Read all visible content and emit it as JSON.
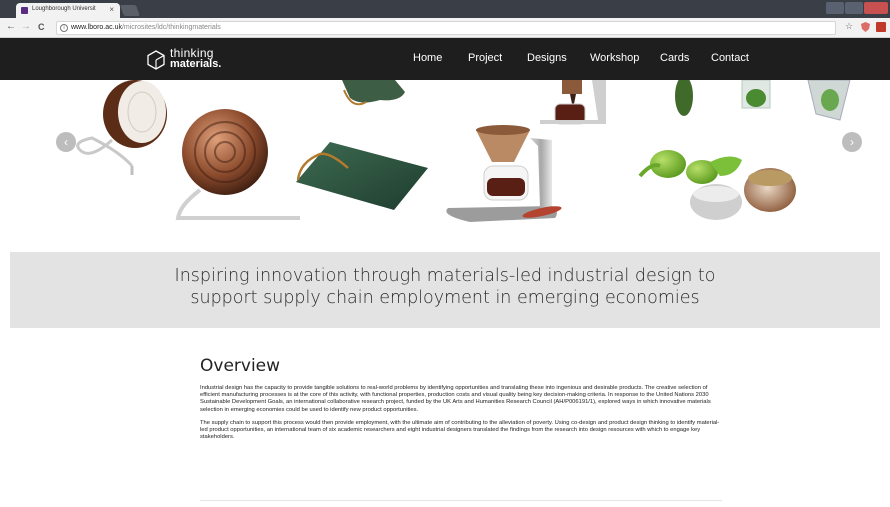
{
  "browser": {
    "tab_title": "Loughborough Universit",
    "tab_close": "×",
    "url_host": "www.lboro.ac.uk",
    "url_path": "/microsites/ldc/thinkingmaterials",
    "back": "←",
    "forward": "→",
    "reload": "C",
    "info": "i",
    "star": "☆"
  },
  "site": {
    "logo_line1": "thinking",
    "logo_line2": "materials.",
    "nav": [
      "Home",
      "Project",
      "Designs",
      "Workshop",
      "Cards",
      "Contact"
    ]
  },
  "carousel": {
    "prev_icon": "‹",
    "next_icon": "›"
  },
  "tagline": {
    "line1": "Inspiring innovation through materials-led industrial design to",
    "line2": "support supply chain employment in emerging economies"
  },
  "overview": {
    "heading": "Overview",
    "para1": "Industrial design has the capacity to provide tangible solutions to real-world problems by identifying opportunities and translating these into ingenious and desirable products. The creative selection of efficient manufacturing processes is at the core of this activity, with functional properties, production costs and visual quality being key decision-making criteria. In response to the United Nations 2030 Sustainable Development Goals, an international collaborative research project, funded by the UK Arts and Humanities Research Council (AH/P006191/1), explored ways in which innovative materials selection in emerging economies could be used to identify new product opportunities.",
    "para2": "The supply chain to support this process would then provide employment, with the ultimate aim of contributing to the alleviation of poverty. Using co-design and product design thinking to identify material-led product opportunities, an international team of six academic researchers and eight industrial designers translated the findings from the research into design resources with which to engage key stakeholders."
  },
  "colors": {
    "nav_bg": "#1e1e1e",
    "band_bg": "#e3e3e3"
  }
}
